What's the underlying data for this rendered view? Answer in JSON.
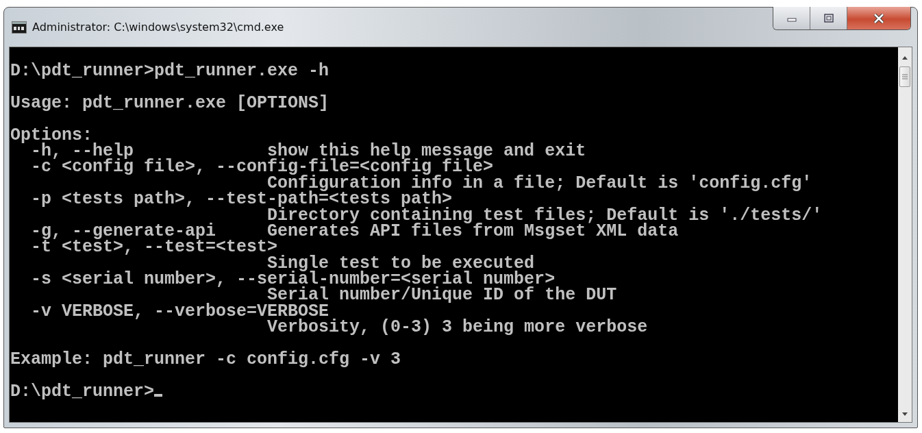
{
  "window": {
    "title": "Administrator: C:\\windows\\system32\\cmd.exe"
  },
  "console": {
    "blocks": [
      [
        "D:\\pdt_runner>pdt_runner.exe -h"
      ],
      [
        "Usage: pdt_runner.exe [OPTIONS]"
      ],
      [
        "Options:",
        "  -h, --help             show this help message and exit",
        "  -c <config file>, --config-file=<config file>",
        "                         Configuration info in a file; Default is 'config.cfg'",
        "  -p <tests path>, --test-path=<tests path>",
        "                         Directory containing test files; Default is './tests/'",
        "  -g, --generate-api     Generates API files from Msgset XML data",
        "  -t <test>, --test=<test>",
        "                         Single test to be executed",
        "  -s <serial number>, --serial-number=<serial number>",
        "                         Serial number/Unique ID of the DUT",
        "  -v VERBOSE, --verbose=VERBOSE",
        "                         Verbosity, (0-3) 3 being more verbose"
      ],
      [
        "Example: pdt_runner -c config.cfg -v 3"
      ]
    ],
    "prompt": "D:\\pdt_runner>"
  }
}
